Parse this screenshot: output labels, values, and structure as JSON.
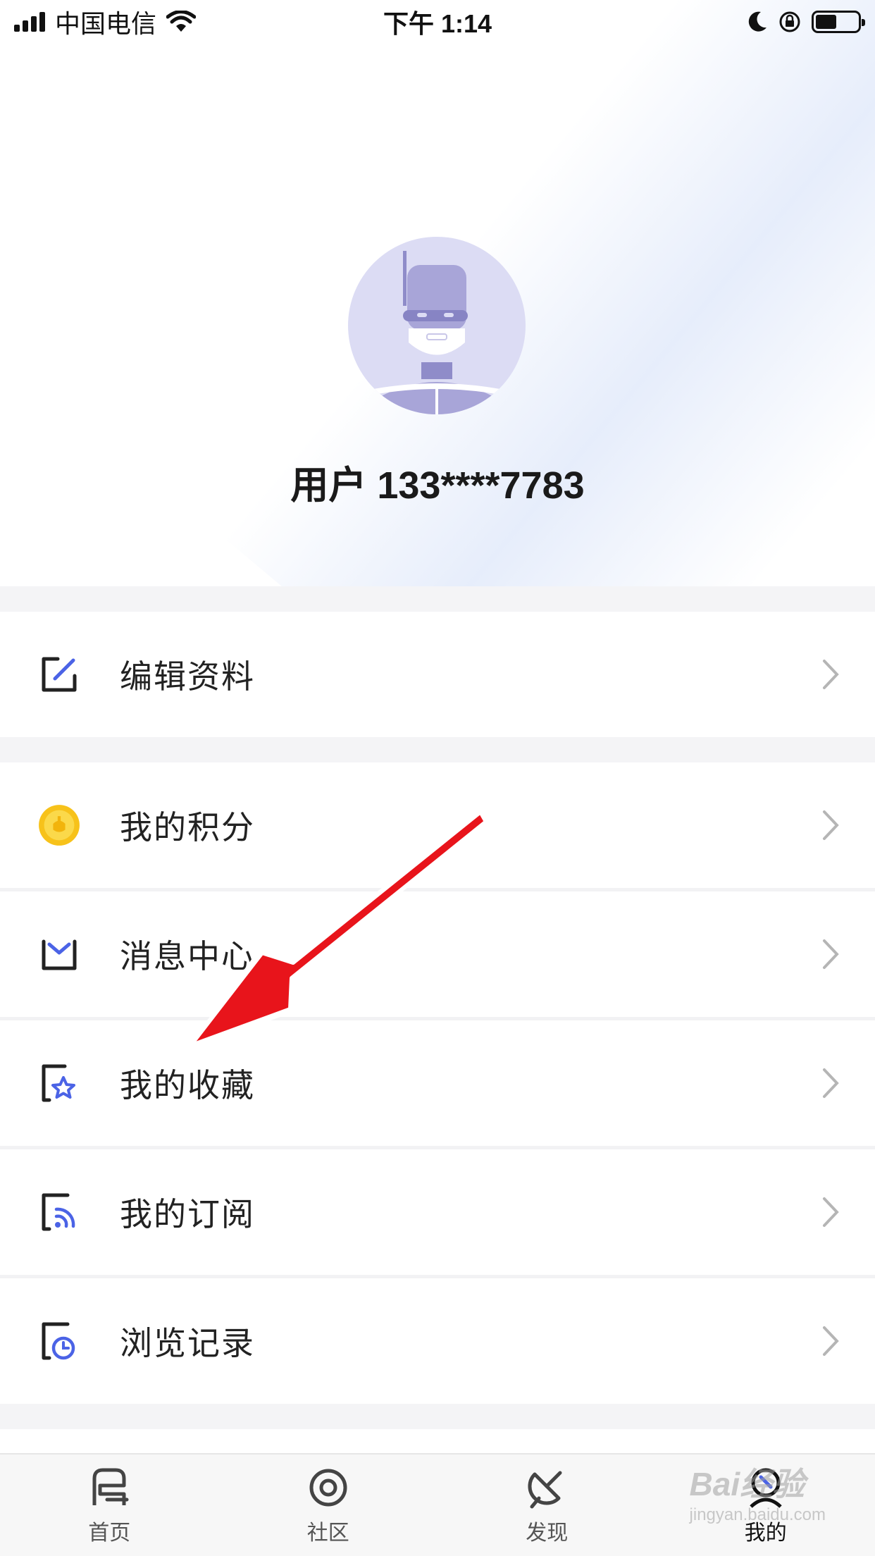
{
  "status_bar": {
    "carrier": "中国电信",
    "time": "下午 1:14",
    "battery_level": 0.5
  },
  "profile": {
    "username": "用户 133****7783",
    "avatar_icon": "robot-avatar-icon"
  },
  "menu": {
    "items": [
      {
        "label": "编辑资料",
        "icon": "edit-icon"
      },
      {
        "label": "我的积分",
        "icon": "coin-icon"
      },
      {
        "label": "消息中心",
        "icon": "mail-icon"
      },
      {
        "label": "我的收藏",
        "icon": "favorite-star-icon"
      },
      {
        "label": "我的订阅",
        "icon": "subscribe-rss-icon"
      },
      {
        "label": "浏览记录",
        "icon": "history-clock-icon"
      }
    ]
  },
  "tabbar": {
    "tabs": [
      {
        "label": "首页",
        "icon": "home-icon"
      },
      {
        "label": "社区",
        "icon": "community-icon"
      },
      {
        "label": "发现",
        "icon": "discover-satellite-icon"
      },
      {
        "label": "我的",
        "icon": "profile-icon",
        "active": true
      }
    ]
  },
  "watermark": {
    "brand": "Bai经验",
    "url": "jingyan.baidu.com"
  },
  "colors": {
    "accent_blue": "#4b63e6",
    "coin_yellow": "#f7c21a",
    "annotation_red": "#e8141b",
    "avatar_bg": "#dcdcf4"
  }
}
